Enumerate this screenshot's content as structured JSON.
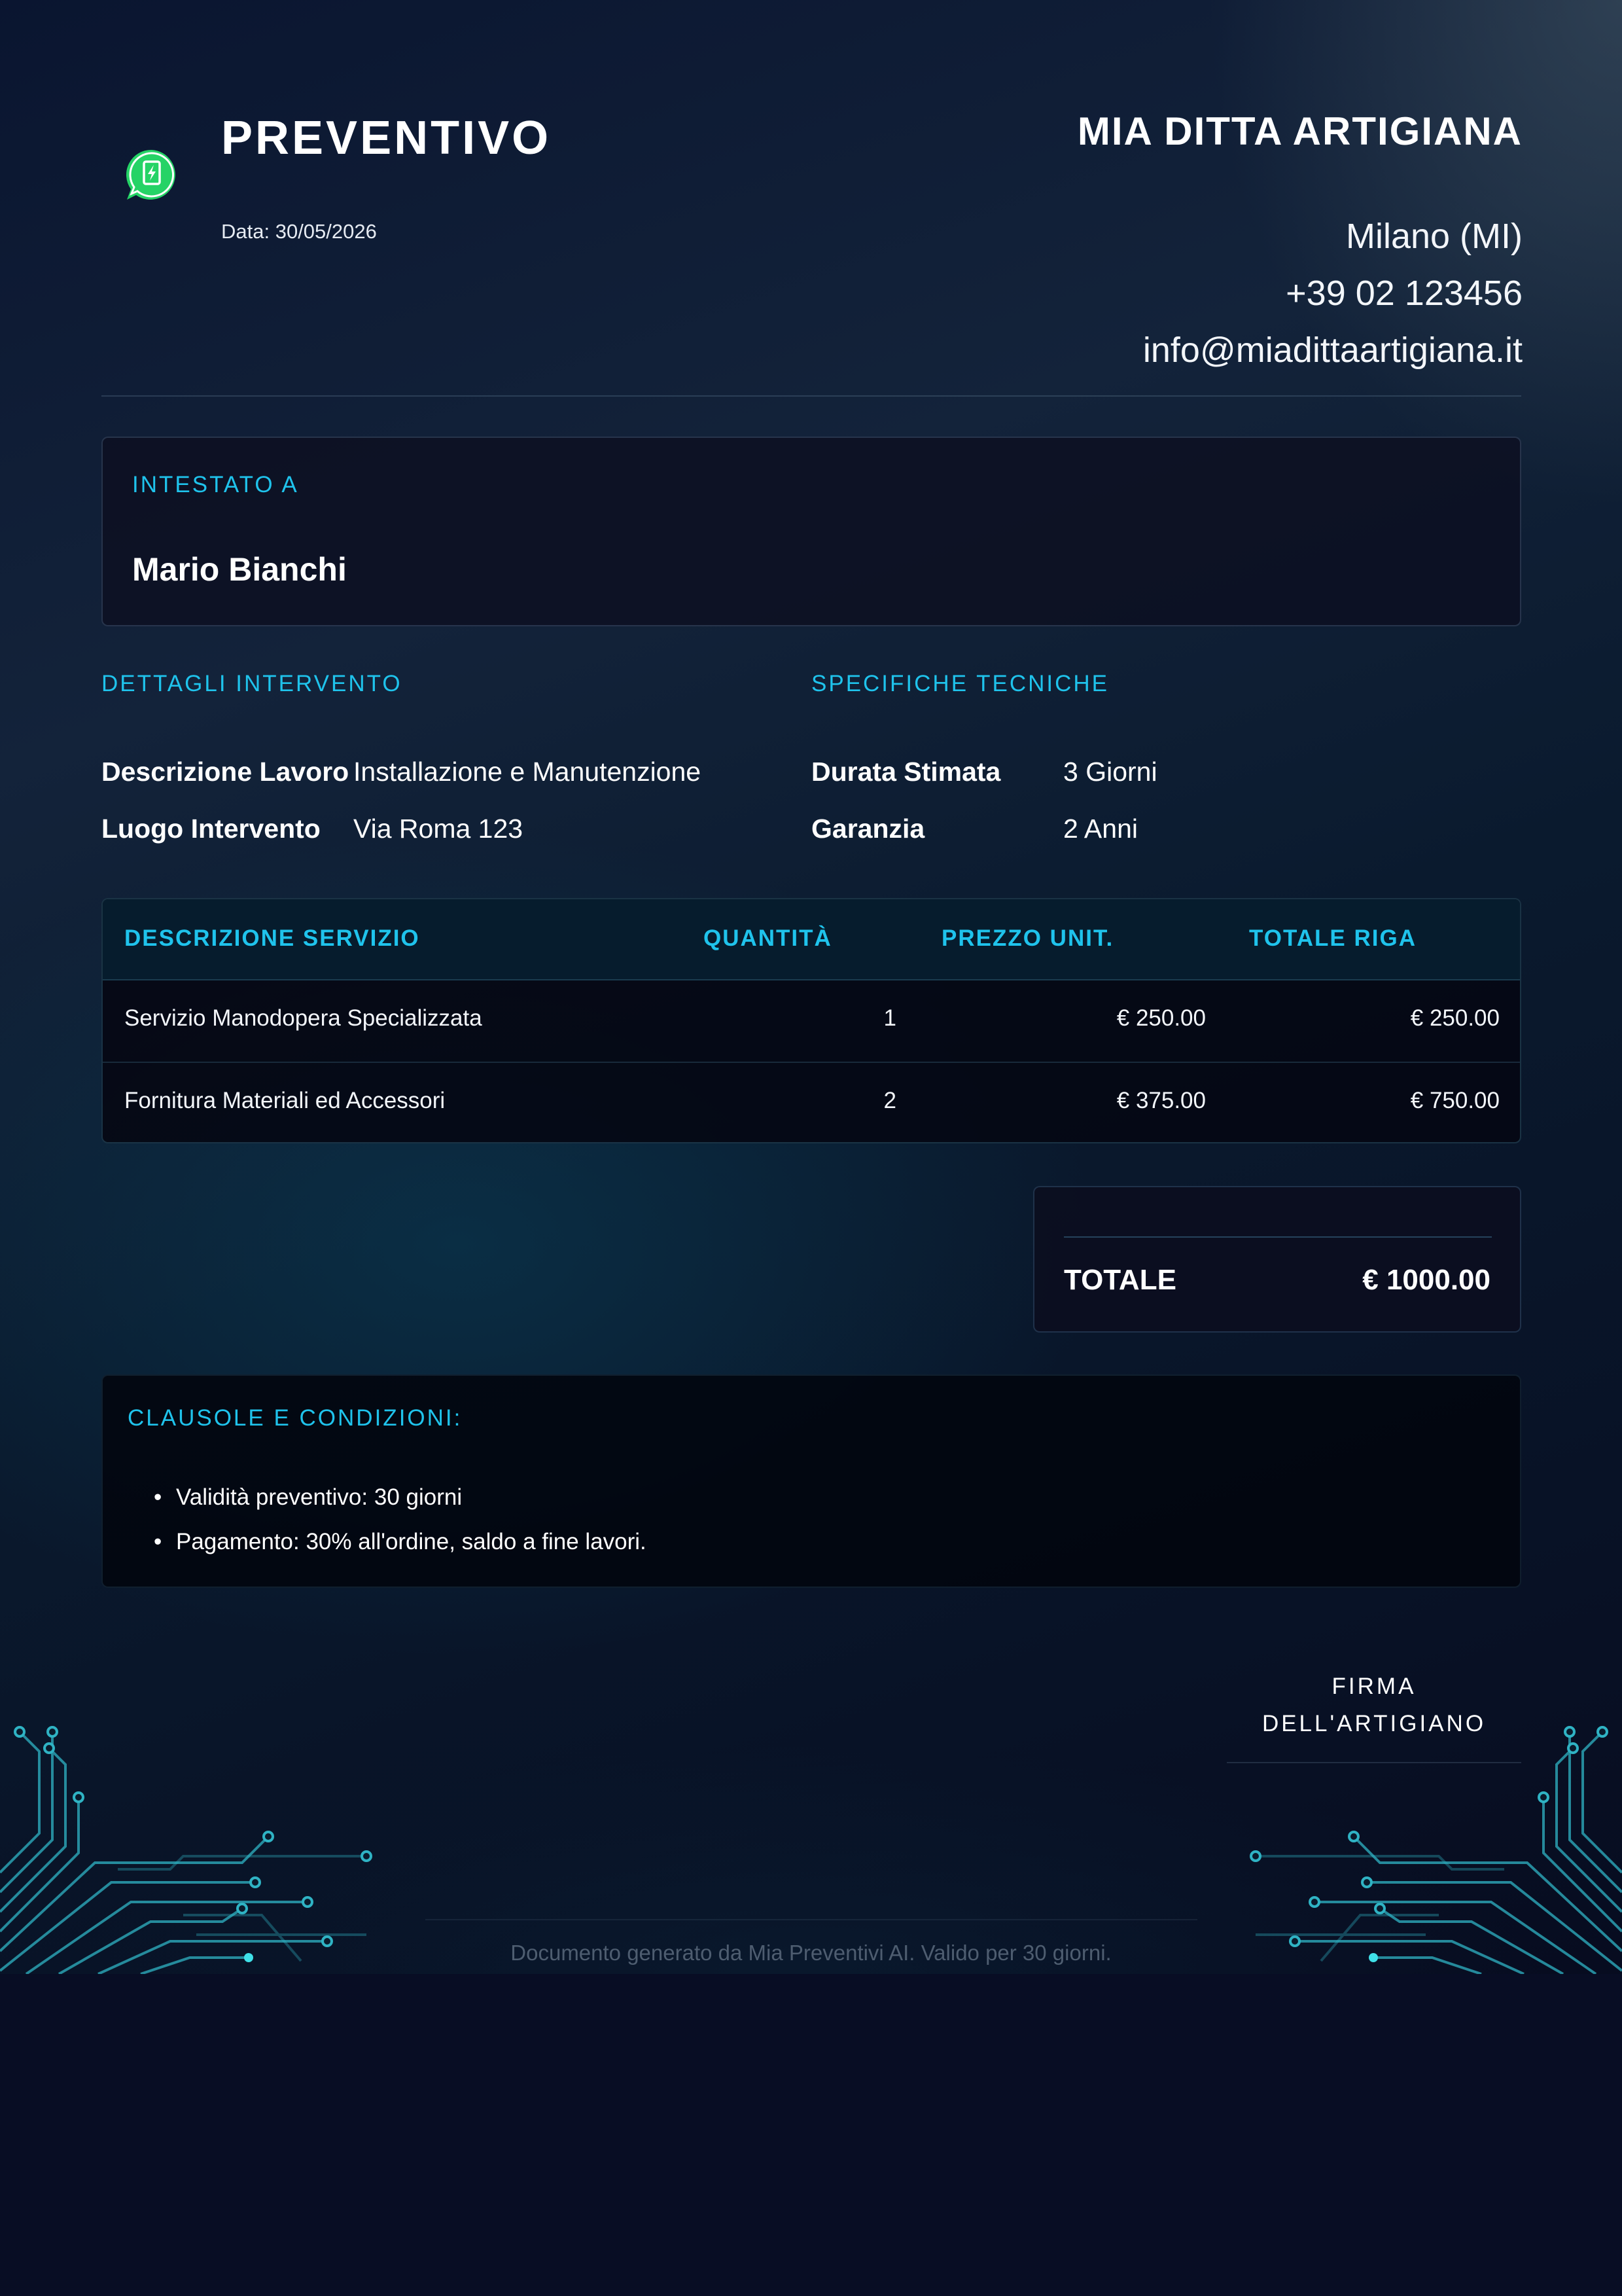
{
  "header": {
    "logo_icon": "invoice-bolt-icon",
    "title": "PREVENTIVO",
    "date": "Data: 30/05/2026"
  },
  "company": {
    "name": "MIA DITTA ARTIGIANA",
    "city": "Milano (MI)",
    "phone": "+39 02 123456",
    "email": "info@miadittaartigiana.it"
  },
  "client": {
    "label": "INTESTATO A",
    "name": "Mario Bianchi"
  },
  "details": {
    "label": "DETTAGLI INTERVENTO",
    "rows": [
      {
        "key": "Descrizione Lavoro",
        "value": "Installazione e Manutenzione"
      },
      {
        "key": "Luogo Intervento",
        "value": "Via Roma 123"
      }
    ]
  },
  "specs": {
    "label": "SPECIFICHE TECNICHE",
    "rows": [
      {
        "key": "Durata Stimata",
        "value": "3 Giorni"
      },
      {
        "key": "Garanzia",
        "value": "2 Anni"
      }
    ]
  },
  "table": {
    "headers": [
      "DESCRIZIONE SERVIZIO",
      "QUANTITÀ",
      "PREZZO UNIT.",
      "TOTALE RIGA"
    ],
    "rows": [
      [
        "Servizio Manodopera Specializzata",
        "1",
        "€ 250.00",
        "€ 250.00"
      ],
      [
        "Fornitura Materiali ed Accessori",
        "2",
        "€ 375.00",
        "€ 750.00"
      ]
    ]
  },
  "total": {
    "label": "TOTALE",
    "value": "€ 1000.00"
  },
  "terms": {
    "label": "CLAUSOLE E CONDIZIONI:",
    "items": [
      "Validità preventivo: 30 giorni",
      "Pagamento: 30% all'ordine, saldo a fine lavori."
    ]
  },
  "signature": {
    "line1": "FIRMA",
    "line2": "DELL'ARTIGIANO"
  },
  "footer": "Documento generato da Mia Preventivi AI. Valido per 30 giorni.",
  "colors": {
    "accent": "#1fc3ec",
    "background": "#080d24",
    "logo_green": "#25d366"
  }
}
